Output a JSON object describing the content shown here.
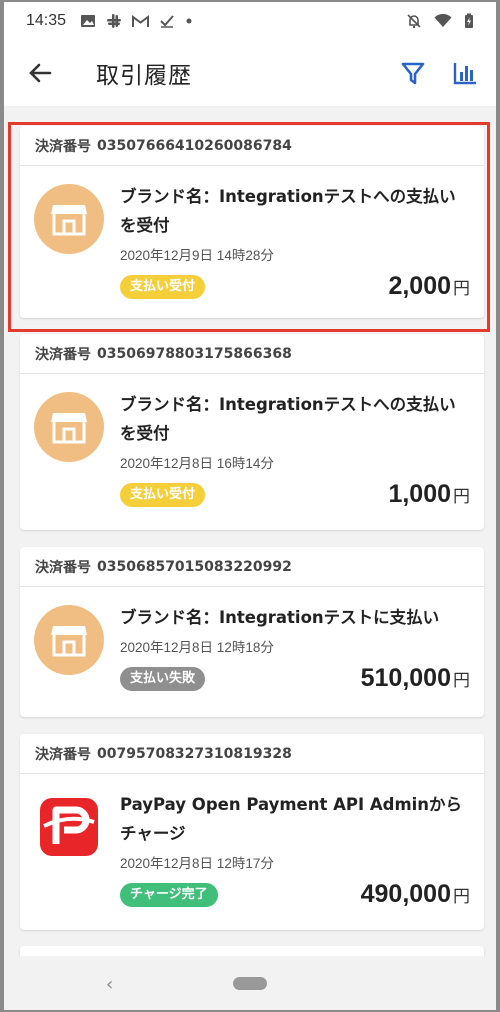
{
  "status_bar": {
    "time": "14:35"
  },
  "app_bar": {
    "title": "取引履歴"
  },
  "colors": {
    "badge_accepted": "#f5cf3a",
    "badge_failed": "#8f8f8f",
    "badge_charged": "#3fbf7a",
    "highlight": "#e23a2d"
  },
  "transactions": [
    {
      "payment_label": "決済番号",
      "payment_number": "03507666410260086784",
      "description": "ブランド名：Integrationテストへの支払いを受付",
      "datetime": "2020年12月9日 14時28分",
      "status": "支払い受付",
      "amount": "2,000",
      "currency": "円",
      "icon": "store-icon"
    },
    {
      "payment_label": "決済番号",
      "payment_number": "03506978803175866368",
      "description": "ブランド名：Integrationテストへの支払いを受付",
      "datetime": "2020年12月8日 16時14分",
      "status": "支払い受付",
      "amount": "1,000",
      "currency": "円",
      "icon": "store-icon"
    },
    {
      "payment_label": "決済番号",
      "payment_number": "03506857015083220992",
      "description": "ブランド名：Integrationテストに支払い",
      "datetime": "2020年12月8日 12時18分",
      "status": "支払い失敗",
      "amount": "510,000",
      "currency": "円",
      "icon": "store-icon"
    },
    {
      "payment_label": "決済番号",
      "payment_number": "00795708327310819328",
      "description": "PayPay Open Payment API Adminからチャージ",
      "datetime": "2020年12月8日 12時17分",
      "status": "チャージ完了",
      "amount": "490,000",
      "currency": "円",
      "icon": "paypay-icon"
    }
  ]
}
